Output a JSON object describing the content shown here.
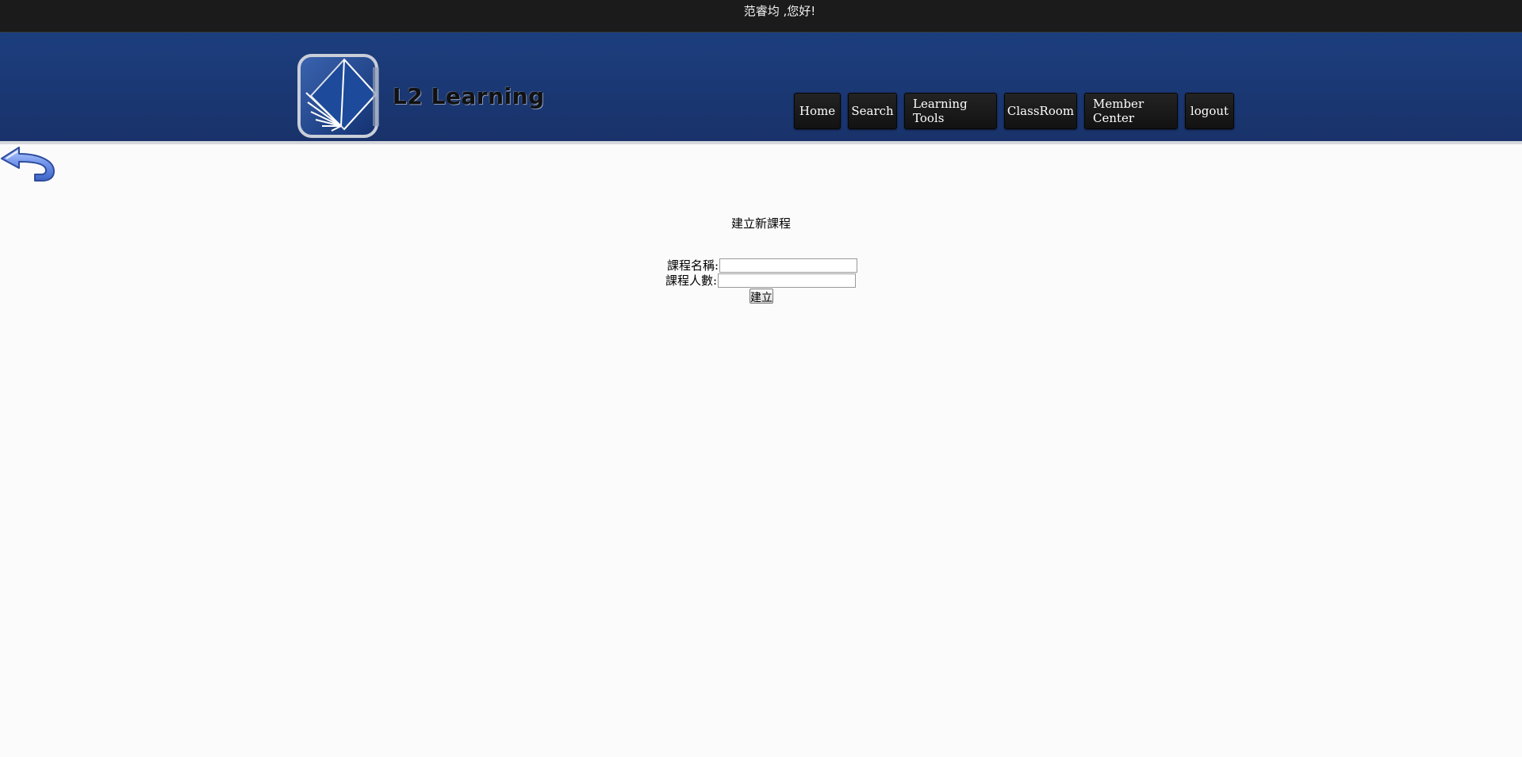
{
  "greeting": "范睿均 ,您好!",
  "logo": {
    "text": "L2 Learning"
  },
  "nav": [
    {
      "label": "Home"
    },
    {
      "label": "Search"
    },
    {
      "label": "Learning Tools"
    },
    {
      "label": "ClassRoom"
    },
    {
      "label": "Member Center"
    },
    {
      "label": "logout"
    }
  ],
  "form": {
    "title": "建立新課程",
    "course_name_label": "課程名稱:",
    "course_name_value": "",
    "course_size_label": "課程人數:",
    "course_size_value": "",
    "submit_label": "建立"
  },
  "colors": {
    "topbar": "#1b1b1b",
    "header": "#1c3e7e",
    "nav_button": "#1a1a1a",
    "background": "#fbfbfc"
  },
  "icons": {
    "back": "back-arrow-icon",
    "logo": "book-logo-icon"
  }
}
